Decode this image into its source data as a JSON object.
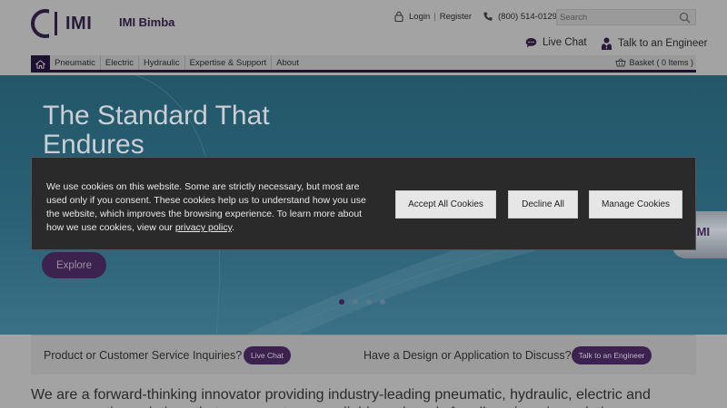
{
  "brand": {
    "logo_text": "IMI",
    "name": "IMI Bimba"
  },
  "utility": {
    "login": "Login",
    "register": "Register",
    "phone": "(800) 514-0129",
    "search_placeholder": "Search"
  },
  "contact": {
    "chat": "Live Chat",
    "engineer": "Talk to an Engineer"
  },
  "nav": {
    "items": [
      "Pneumatic",
      "Electric",
      "Hydraulic",
      "Expertise & Support",
      "About"
    ],
    "basket": "Basket ( 0 Items )"
  },
  "hero": {
    "title": "The Standard That Endures",
    "cta": "Explore",
    "product_logo": "IMI"
  },
  "cookie": {
    "message": "We use cookies on this website. Some are strictly necessary, but most are used only if you consent. These cookies help us to understand how you use the website, which improves the browsing experience. To learn more about how we use cookies, view our ",
    "link": "privacy policy",
    "end": ".",
    "accept": "Accept All Cookies",
    "decline": "Decline All",
    "manage": "Manage Cookies"
  },
  "inquiries": {
    "product_text": "Product or Customer Service Inquiries?",
    "product_btn": "Live Chat",
    "design_text": "Have a Design or Application to Discuss?",
    "design_btn": "Talk to an Engineer"
  },
  "intro": "We are a forward-thinking innovator providing industry-leading pneumatic, hydraulic, electric and vacuum motion solutions that are easy to use, reliable and ready for all engineering solutions."
}
